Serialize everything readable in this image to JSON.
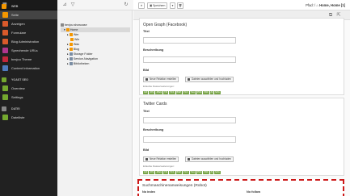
{
  "modules": {
    "sections": [
      {
        "label": "WEB"
      },
      {
        "label": "YOAST SEO"
      },
      {
        "label": "DATEI"
      }
    ],
    "web_items": [
      {
        "label": "Seite",
        "icon": "page-icon",
        "color": "#f49700",
        "active": true
      },
      {
        "label": "Anzeigen",
        "icon": "view-icon",
        "color": "#d95a2b"
      },
      {
        "label": "Formulare",
        "icon": "form-icon",
        "color": "#d95a2b"
      },
      {
        "label": "Blog Administration",
        "icon": "blog-icon",
        "color": "#d95a2b"
      },
      {
        "label": "Sprechende URLs",
        "icon": "urls-icon",
        "color": "#b0368e"
      },
      {
        "label": "bexjou Theme",
        "icon": "theme-icon",
        "color": "#c3273c"
      },
      {
        "label": "Content Information",
        "icon": "info-icon",
        "color": "#4f7bbe"
      }
    ],
    "yoast_items": [
      {
        "label": "Overview",
        "icon": "overview-icon",
        "color": "#74a82f"
      },
      {
        "label": "Settings",
        "icon": "settings-icon",
        "color": "#74a82f"
      }
    ],
    "datei_items": [
      {
        "label": "Dateiliste",
        "icon": "filelist-icon",
        "color": "#74a82f"
      }
    ]
  },
  "tree": {
    "root": "bexjou showcase",
    "nodes": [
      {
        "label": "Home",
        "selected": true
      },
      {
        "label": "Wer"
      },
      {
        "label": "Wie"
      },
      {
        "label": "Was"
      },
      {
        "label": "Blog"
      },
      {
        "label": "Storage Folder"
      },
      {
        "label": "Service-Navigation"
      },
      {
        "label": "Bibliotheken"
      }
    ]
  },
  "doc": {
    "save_label": "Speichern",
    "breadcrumb_prefix": "Pfad: /",
    "breadcrumb_path": "Home, Home",
    "breadcrumb_id": "[1]"
  },
  "og_panel": {
    "title": "Open Graph (Facebook)",
    "titel_label": "Titel",
    "desc_label": "Beschreibung",
    "bild_label": "Bild",
    "new_relation": "Neue Relation erstellen",
    "select_files": "Dateien auswählen und hochladen",
    "allowed_label": "Erlaubte Dateierweiterungen:",
    "extensions": [
      "GIF",
      "JPG",
      "JPEG",
      "TIF",
      "TIFF",
      "BMP",
      "PCX",
      "TGA",
      "PNG",
      "PDF",
      "AI",
      "SVG"
    ]
  },
  "twitter_panel": {
    "title": "Twitter Cards",
    "titel_label": "Titel",
    "desc_label": "Beschreibung",
    "bild_label": "Bild",
    "new_relation": "Neue Relation erstellen",
    "select_files": "Dateien auswählen und hochladen",
    "allowed_label": "Erlaubte Dateierweiterungen:",
    "extensions": [
      "GIF",
      "JPG",
      "JPEG",
      "TIF",
      "TIFF",
      "BMP",
      "PCX",
      "TGA",
      "PNG",
      "PDF",
      "AI",
      "SVG"
    ]
  },
  "robots": {
    "title": "Suchmaschinenanweisungen (Robot)",
    "noindex": "No index",
    "nofollow": "No follow"
  },
  "colors": {
    "highlight_border": "#cc1818",
    "extension_badge": "#79a548"
  }
}
